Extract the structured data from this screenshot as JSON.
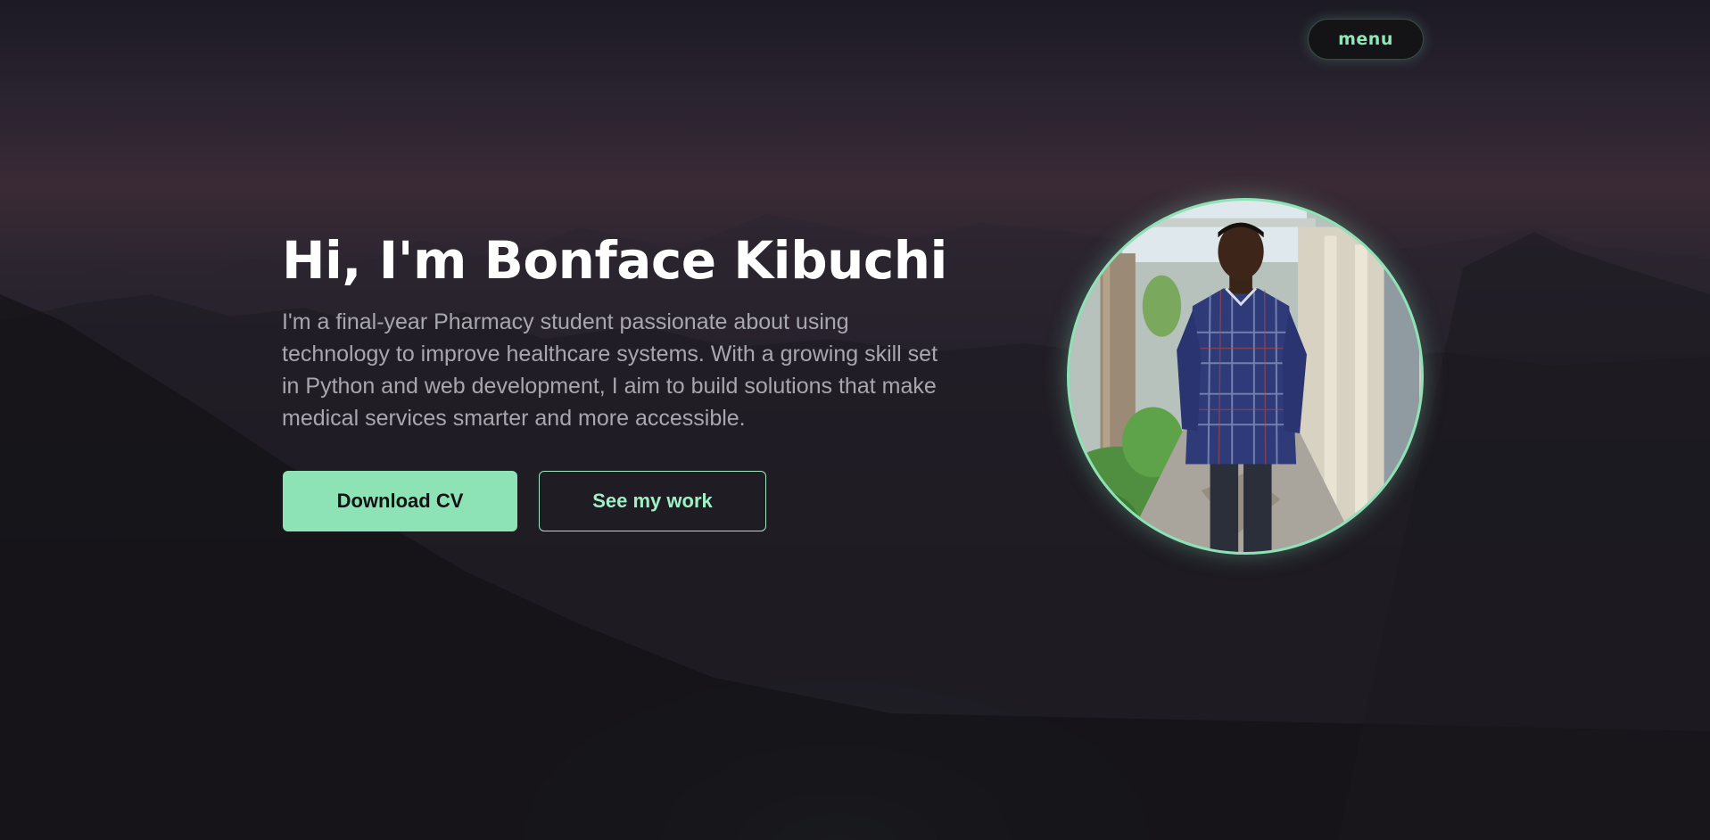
{
  "nav": {
    "menu_label": "menu"
  },
  "hero": {
    "title": "Hi, I'm Bonface Kibuchi",
    "description": "I'm a final-year Pharmacy student passionate about using technology to improve healthcare systems. With a growing skill set in Python and web development, I aim to build solutions that make medical services smarter and more accessible.",
    "primary_button": "Download CV",
    "secondary_button": "See my work"
  },
  "colors": {
    "accent": "#8ee3b6",
    "accent_text": "#9ff0c6",
    "title": "#ffffff",
    "body_text": "#a7a7ad",
    "background": "#0f0f12"
  },
  "icons": {
    "avatar": "profile-photo"
  }
}
